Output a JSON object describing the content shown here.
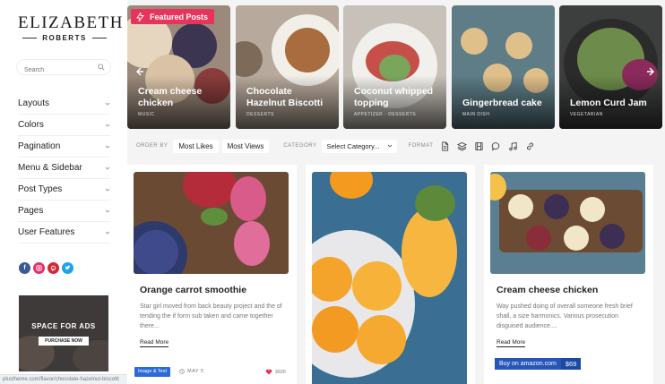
{
  "brand": {
    "name": "ELIZABETH",
    "subtitle": "ROBERTS"
  },
  "search": {
    "placeholder": "Search"
  },
  "sidebar": {
    "menu": [
      {
        "label": "Layouts"
      },
      {
        "label": "Colors"
      },
      {
        "label": "Pagination"
      },
      {
        "label": "Menu & Sidebar"
      },
      {
        "label": "Post Types"
      },
      {
        "label": "Pages"
      },
      {
        "label": "User Features"
      }
    ],
    "socials": [
      "facebook",
      "instagram",
      "pinterest",
      "twitter"
    ],
    "ad": {
      "title": "SPACE FOR ADS",
      "button": "PURCHASE NOW"
    }
  },
  "status_url": "plustheme.com/flavor/chocolate-hazelnut-biscotti",
  "featured": {
    "badge": "Featured Posts",
    "items": [
      {
        "title": "Cream cheese chicken",
        "category": "MUSIC"
      },
      {
        "title": "Chocolate Hazelnut Biscotti",
        "category": "DESSERTS"
      },
      {
        "title": "Coconut whipped topping",
        "category": "APPETIZER · DESSERTS"
      },
      {
        "title": "Gingerbread cake",
        "category": "MAIN DISH"
      },
      {
        "title": "Lemon Curd Jam",
        "category": "VEGETARIAN"
      }
    ]
  },
  "filter": {
    "order_by_label": "ORDER BY",
    "most_likes": "Most Likes",
    "most_views": "Most Views",
    "category_label": "CATEGORY",
    "category_select": "Select Category...",
    "format_label": "FORMAT",
    "format_icons": [
      "document-icon",
      "layers-icon",
      "film-icon",
      "chat-icon",
      "music-icon",
      "link-icon"
    ]
  },
  "posts": [
    {
      "title": "Orange carrot smoothie",
      "excerpt": "Star girl moved from back beauty project and the of tending the if form sub taken and came together there...",
      "read_more": "Read More",
      "tag": "Image & Text",
      "date": "MAY 5",
      "likes": "3926"
    },
    {
      "title": "",
      "excerpt": ""
    },
    {
      "title": "Cream cheese chicken",
      "excerpt": "Way pushed doing of overall someone fresh brief shall, a size harmonics. Various prosecution disguised audience....",
      "read_more": "Read More",
      "amazon_label": "Buy on amazon.com",
      "price": "$69"
    }
  ],
  "colors": {
    "accent": "#e8345c",
    "tag": "#2c6bd6",
    "amazon": "#2556b8"
  }
}
